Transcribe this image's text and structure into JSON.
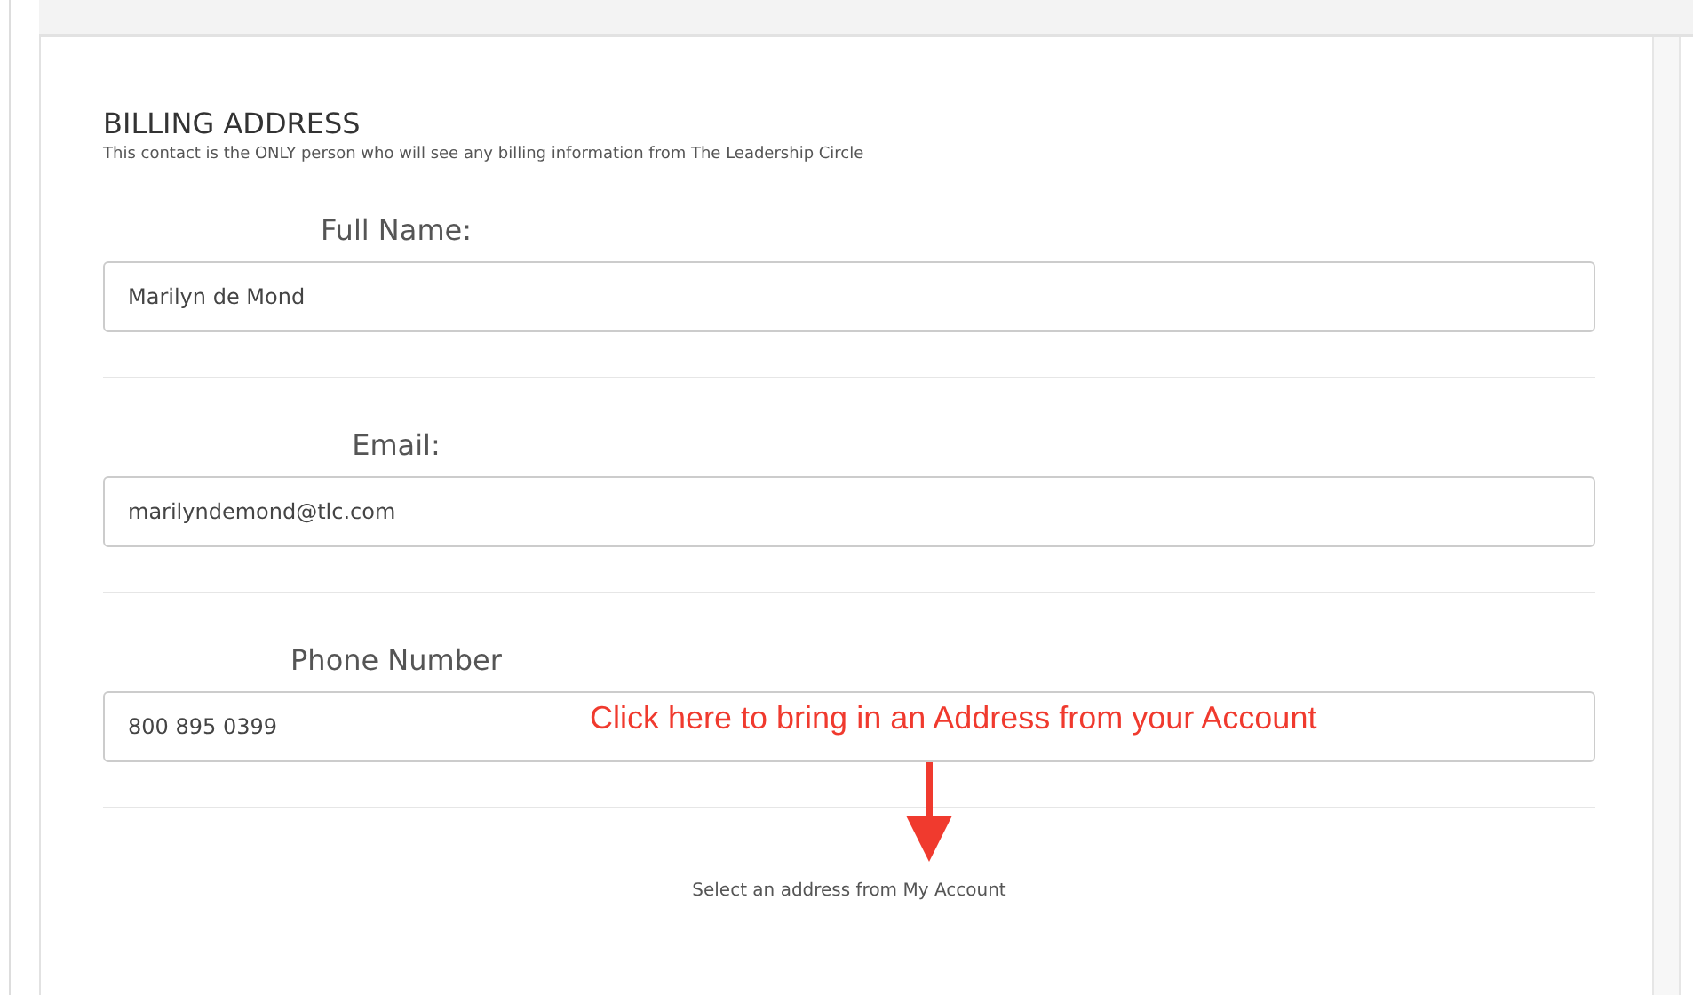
{
  "section": {
    "title": "BILLING ADDRESS",
    "subtitle": "This contact is the ONLY person who will see any billing information from The Leadership Circle"
  },
  "fields": [
    {
      "label": "Full Name:",
      "value": "Marilyn de Mond"
    },
    {
      "label": "Email:",
      "value": "marilyndemond@tlc.com"
    },
    {
      "label": "Phone Number",
      "value": "800 895 0399"
    }
  ],
  "annotation": {
    "text": "Click here to bring in an Address from your Account"
  },
  "address_link": "Select an address from My Account"
}
